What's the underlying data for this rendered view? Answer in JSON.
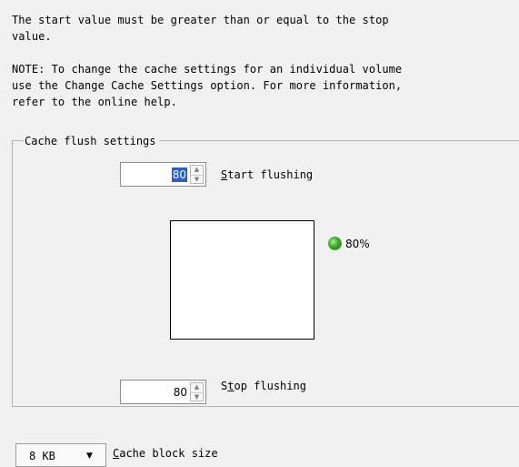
{
  "intro": {
    "line1": "The start value must be greater than or equal to the stop",
    "line2": "value."
  },
  "note": {
    "line1": "NOTE: To change the cache settings for an individual volume",
    "line2": "use the Change Cache Settings option. For more information,",
    "line3": "refer to the online help."
  },
  "group": {
    "title": "Cache flush settings"
  },
  "start": {
    "value": "80",
    "label_key": "S",
    "label_rest": "tart flushing"
  },
  "indicator": {
    "value_text": "80%",
    "level_percent": 80,
    "color": "#3fae2c"
  },
  "stop": {
    "value": "80",
    "label_pre": "S",
    "label_key": "t",
    "label_rest": "op flushing"
  },
  "block_size": {
    "value": "8 KB",
    "label_key": "C",
    "label_rest": "ache block size"
  }
}
